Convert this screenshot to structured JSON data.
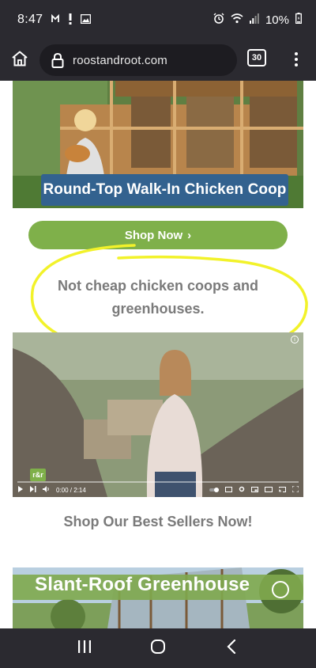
{
  "status": {
    "time": "8:47",
    "battery": "10%",
    "icons": [
      "messenger-icon",
      "alert-icon",
      "gallery-icon",
      "alarm-icon",
      "wifi-icon",
      "signal-icon",
      "battery-icon"
    ]
  },
  "browser": {
    "url": "roostandroot.com",
    "tab_count": "30"
  },
  "hero": {
    "caption": "Round-Top Walk-In Chicken Coop"
  },
  "shop_button": {
    "label": "Shop Now",
    "chevron": "›"
  },
  "tagline": "Not cheap chicken coops and greenhouses.",
  "video": {
    "logo": "r&r",
    "time": "0:00 / 2:14"
  },
  "section_heading": "Shop Our Best Sellers Now!",
  "promo": {
    "title": "Slant-Roof Greenhouse"
  },
  "colors": {
    "accent_green": "#7fb04a",
    "caption_blue": "#33628f",
    "text_gray": "#7a7a7a",
    "highlight_yellow": "#f2f22a",
    "chrome_dark": "#2b2a30"
  }
}
